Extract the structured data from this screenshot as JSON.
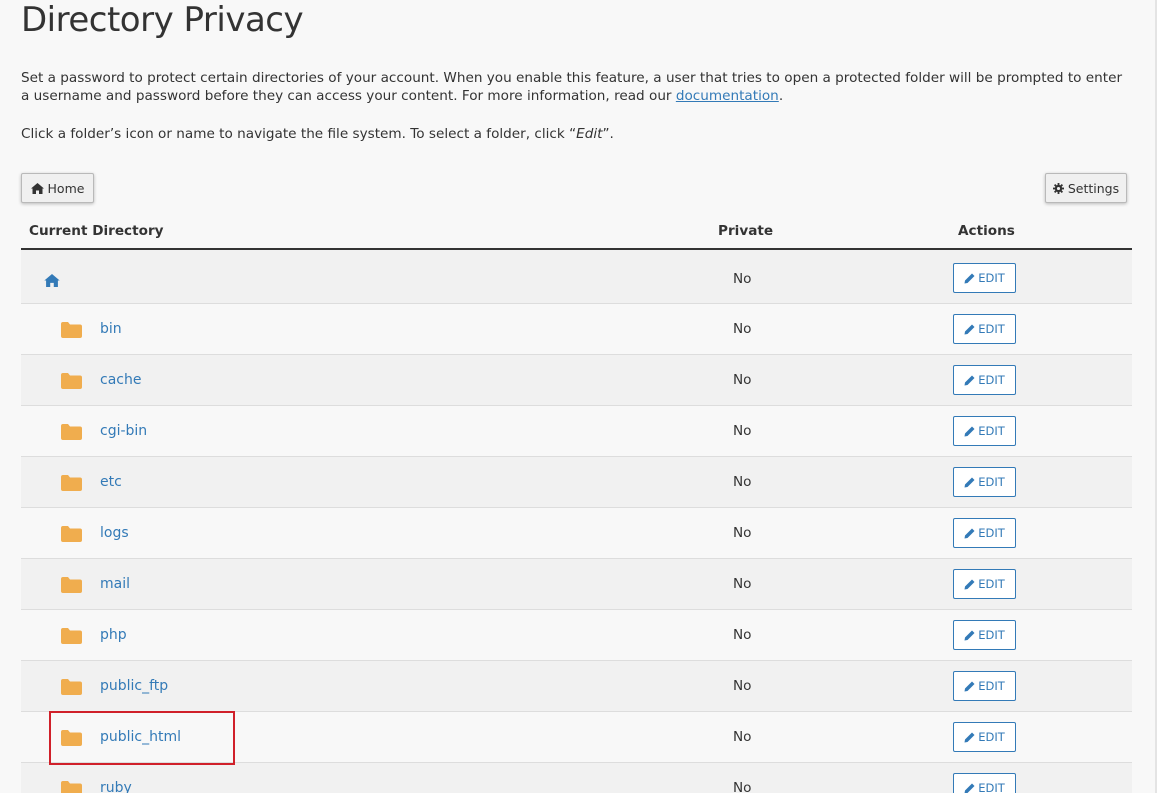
{
  "page": {
    "title": "Directory Privacy",
    "intro_text": "Set a password to protect certain directories of your account. When you enable this feature, a user that tries to open a protected folder will be prompted to enter a username and password before they can access your content. For more information, read our ",
    "intro_link": "documentation",
    "intro_end": ".",
    "hint_pre": "Click a folder’s icon or name to navigate the file system. To select a folder, click “",
    "hint_em": "Edit",
    "hint_post": "”."
  },
  "toolbar": {
    "home_label": "Home",
    "home_icon": "home-icon",
    "settings_label": "Settings",
    "settings_icon": "gear-icon"
  },
  "table": {
    "headers": {
      "directory": "Current Directory",
      "private": "Private",
      "actions": "Actions"
    },
    "edit_label": "EDIT",
    "root_row": {
      "icon": "home-icon",
      "private": "No"
    },
    "rows": [
      {
        "name": "bin",
        "private": "No"
      },
      {
        "name": "cache",
        "private": "No"
      },
      {
        "name": "cgi-bin",
        "private": "No"
      },
      {
        "name": "etc",
        "private": "No"
      },
      {
        "name": "logs",
        "private": "No"
      },
      {
        "name": "mail",
        "private": "No"
      },
      {
        "name": "php",
        "private": "No"
      },
      {
        "name": "public_ftp",
        "private": "No"
      },
      {
        "name": "public_html",
        "private": "No",
        "highlighted": true
      },
      {
        "name": "ruby",
        "private": "No"
      }
    ]
  },
  "colors": {
    "link": "#337ab7",
    "folder": "#f0ad4e",
    "highlight_border": "#d0202a"
  }
}
